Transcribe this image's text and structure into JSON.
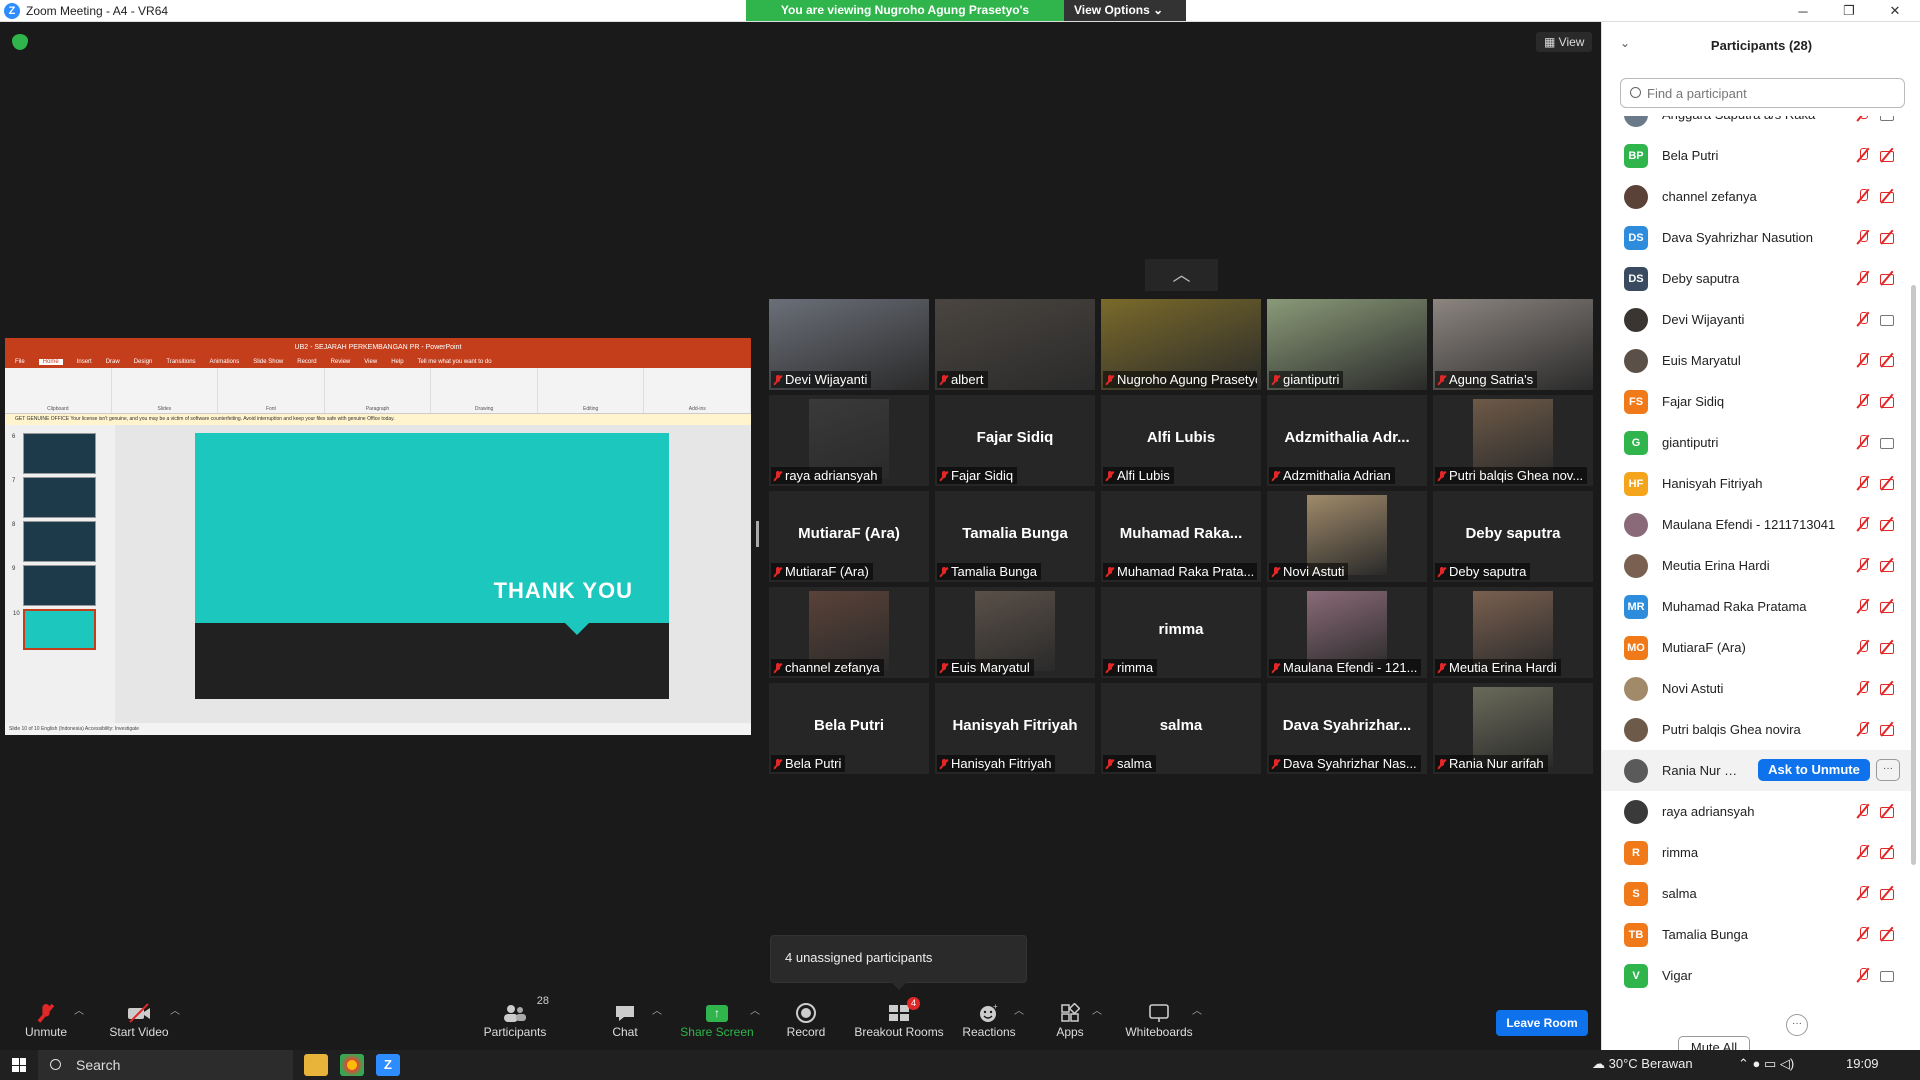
{
  "window": {
    "title": "Zoom Meeting - A4 - VR64",
    "minimize": "─",
    "restore": "❐",
    "close": "✕"
  },
  "banner": {
    "viewing_text": "You are viewing Nugroho Agung Prasetyo's screen",
    "view_options": "View Options ⌄"
  },
  "view_button": "View",
  "shared_screen": {
    "ppt_title": "UB2 - SEJARAH PERKEMBANGAN PR  -  PowerPoint",
    "tabs": [
      "File",
      "Home",
      "Insert",
      "Draw",
      "Design",
      "Transitions",
      "Animations",
      "Slide Show",
      "Record",
      "Review",
      "View",
      "Help",
      "Tell me what you want to do"
    ],
    "ribbon_groups": [
      "Clipboard",
      "Slides",
      "Font",
      "Paragraph",
      "Drawing",
      "Editing",
      "Add-ins"
    ],
    "message": "GET GENUINE OFFICE   Your license isn't genuine, and you may be a victim of software counterfeiting. Avoid interruption and keep your files safe with genuine Office today.",
    "thumb_numbers": [
      "6",
      "7",
      "8",
      "9",
      "10"
    ],
    "slide_text": "THANK YOU",
    "status": "Slide 10 of 10     English (Indonesia)     Accessibility: Investigate"
  },
  "gallery": {
    "collapse": "︿",
    "tiles": [
      {
        "name": "Devi Wijayanti",
        "big": "",
        "color": "#6b6f78"
      },
      {
        "name": "albert",
        "big": "",
        "color": "#4a4540"
      },
      {
        "name": "Nugroho Agung Prasetyo",
        "big": "",
        "color": "#7a6a2a"
      },
      {
        "name": "giantiputri",
        "big": "",
        "color": "#8a9a78"
      },
      {
        "name": "Agung Satria's",
        "big": "",
        "color": "#8c8580"
      },
      {
        "name": "raya adriansyah",
        "big": "",
        "color": "#3a3a3a"
      },
      {
        "name": "Fajar Sidiq",
        "big": "Fajar Sidiq",
        "color": ""
      },
      {
        "name": "Alfi Lubis",
        "big": "Alfi Lubis",
        "color": ""
      },
      {
        "name": "Adzmithalia Adrian",
        "big": "Adzmithalia  Adr...",
        "color": ""
      },
      {
        "name": "Putri balqis Ghea nov...",
        "big": "",
        "color": "#6e5a48"
      },
      {
        "name": "MutiaraF (Ara)",
        "big": "MutiaraF (Ara)",
        "color": ""
      },
      {
        "name": "Tamalia Bunga",
        "big": "Tamalia Bunga",
        "color": ""
      },
      {
        "name": "Muhamad Raka Prata...",
        "big": "Muhamad  Raka...",
        "color": ""
      },
      {
        "name": "Novi Astuti",
        "big": "",
        "color": "#a08a6a"
      },
      {
        "name": "Deby saputra",
        "big": "Deby saputra",
        "color": ""
      },
      {
        "name": "channel zefanya",
        "big": "",
        "color": "#5a4238"
      },
      {
        "name": "Euis Maryatul",
        "big": "",
        "color": "#5a5048"
      },
      {
        "name": "rimma",
        "big": "rimma",
        "color": ""
      },
      {
        "name": "Maulana Efendi - 121...",
        "big": "",
        "color": "#8a6a78"
      },
      {
        "name": "Meutia Erina Hardi",
        "big": "",
        "color": "#7a6050"
      },
      {
        "name": "Bela Putri",
        "big": "Bela Putri",
        "color": ""
      },
      {
        "name": "Hanisyah Fitriyah",
        "big": "Hanisyah Fitriyah",
        "color": ""
      },
      {
        "name": "salma",
        "big": "salma",
        "color": ""
      },
      {
        "name": "Dava Syahrizhar Nas...",
        "big": "Dava  Syahrizhar...",
        "color": ""
      },
      {
        "name": "Rania Nur arifah",
        "big": "",
        "color": "#6a6a5a"
      }
    ]
  },
  "unassigned": "4 unassigned participants",
  "toolbar": {
    "unmute": "Unmute",
    "start_video": "Start Video",
    "participants": "Participants",
    "participants_count": "28",
    "chat": "Chat",
    "share_screen": "Share Screen",
    "record": "Record",
    "breakout_rooms": "Breakout Rooms",
    "breakout_badge": "4",
    "reactions": "Reactions",
    "apps": "Apps",
    "whiteboards": "Whiteboards",
    "leave_room": "Leave Room"
  },
  "participants_panel": {
    "title": "Participants (28)",
    "search_placeholder": "Find a participant",
    "ask_to_unmute": "Ask to Unmute",
    "more": "···",
    "mute_all": "Mute All",
    "rows": [
      {
        "name": "Anggara Saputra a/s Raka",
        "initials": "",
        "color": "#6a7a88",
        "cam": "on"
      },
      {
        "name": "Bela Putri",
        "initials": "BP",
        "color": "#2fb54c",
        "cam": "off"
      },
      {
        "name": "channel zefanya",
        "initials": "",
        "color": "#5a4238",
        "cam": "off"
      },
      {
        "name": "Dava Syahrizhar Nasution",
        "initials": "DS",
        "color": "#2d8cdc",
        "cam": "off"
      },
      {
        "name": "Deby saputra",
        "initials": "DS",
        "color": "#3a4a60",
        "cam": "off"
      },
      {
        "name": "Devi Wijayanti",
        "initials": "",
        "color": "#3a3530",
        "cam": "on"
      },
      {
        "name": "Euis Maryatul",
        "initials": "",
        "color": "#5a5048",
        "cam": "off"
      },
      {
        "name": "Fajar Sidiq",
        "initials": "FS",
        "color": "#f07a1a",
        "cam": "off"
      },
      {
        "name": "giantiputri",
        "initials": "G",
        "color": "#2fb54c",
        "cam": "on"
      },
      {
        "name": "Hanisyah Fitriyah",
        "initials": "HF",
        "color": "#f4a51c",
        "cam": "off"
      },
      {
        "name": "Maulana Efendi - 1211713041",
        "initials": "",
        "color": "#8a6a78",
        "cam": "off"
      },
      {
        "name": "Meutia Erina Hardi",
        "initials": "",
        "color": "#7a6050",
        "cam": "off"
      },
      {
        "name": "Muhamad Raka Pratama",
        "initials": "MR",
        "color": "#2d8cdc",
        "cam": "off"
      },
      {
        "name": "MutiaraF (Ara)",
        "initials": "MO",
        "color": "#f07a1a",
        "cam": "off"
      },
      {
        "name": "Novi Astuti",
        "initials": "",
        "color": "#a08a6a",
        "cam": "off"
      },
      {
        "name": "Putri balqis Ghea novira",
        "initials": "",
        "color": "#6e5a48",
        "cam": "off"
      },
      {
        "name": "Rania Nur arif...",
        "initials": "",
        "color": "#5a5a5a",
        "cam": "hidden"
      },
      {
        "name": "raya adriansyah",
        "initials": "",
        "color": "#3a3a3a",
        "cam": "off"
      },
      {
        "name": "rimma",
        "initials": "R",
        "color": "#f07a1a",
        "cam": "off"
      },
      {
        "name": "salma",
        "initials": "S",
        "color": "#f07a1a",
        "cam": "off"
      },
      {
        "name": "Tamalia Bunga",
        "initials": "TB",
        "color": "#f07a1a",
        "cam": "off"
      },
      {
        "name": "Vigar",
        "initials": "V",
        "color": "#2fb54c",
        "cam": "on"
      }
    ]
  },
  "taskbar": {
    "search": "Search",
    "weather": "30°C  Berawan",
    "time": "19:09"
  }
}
